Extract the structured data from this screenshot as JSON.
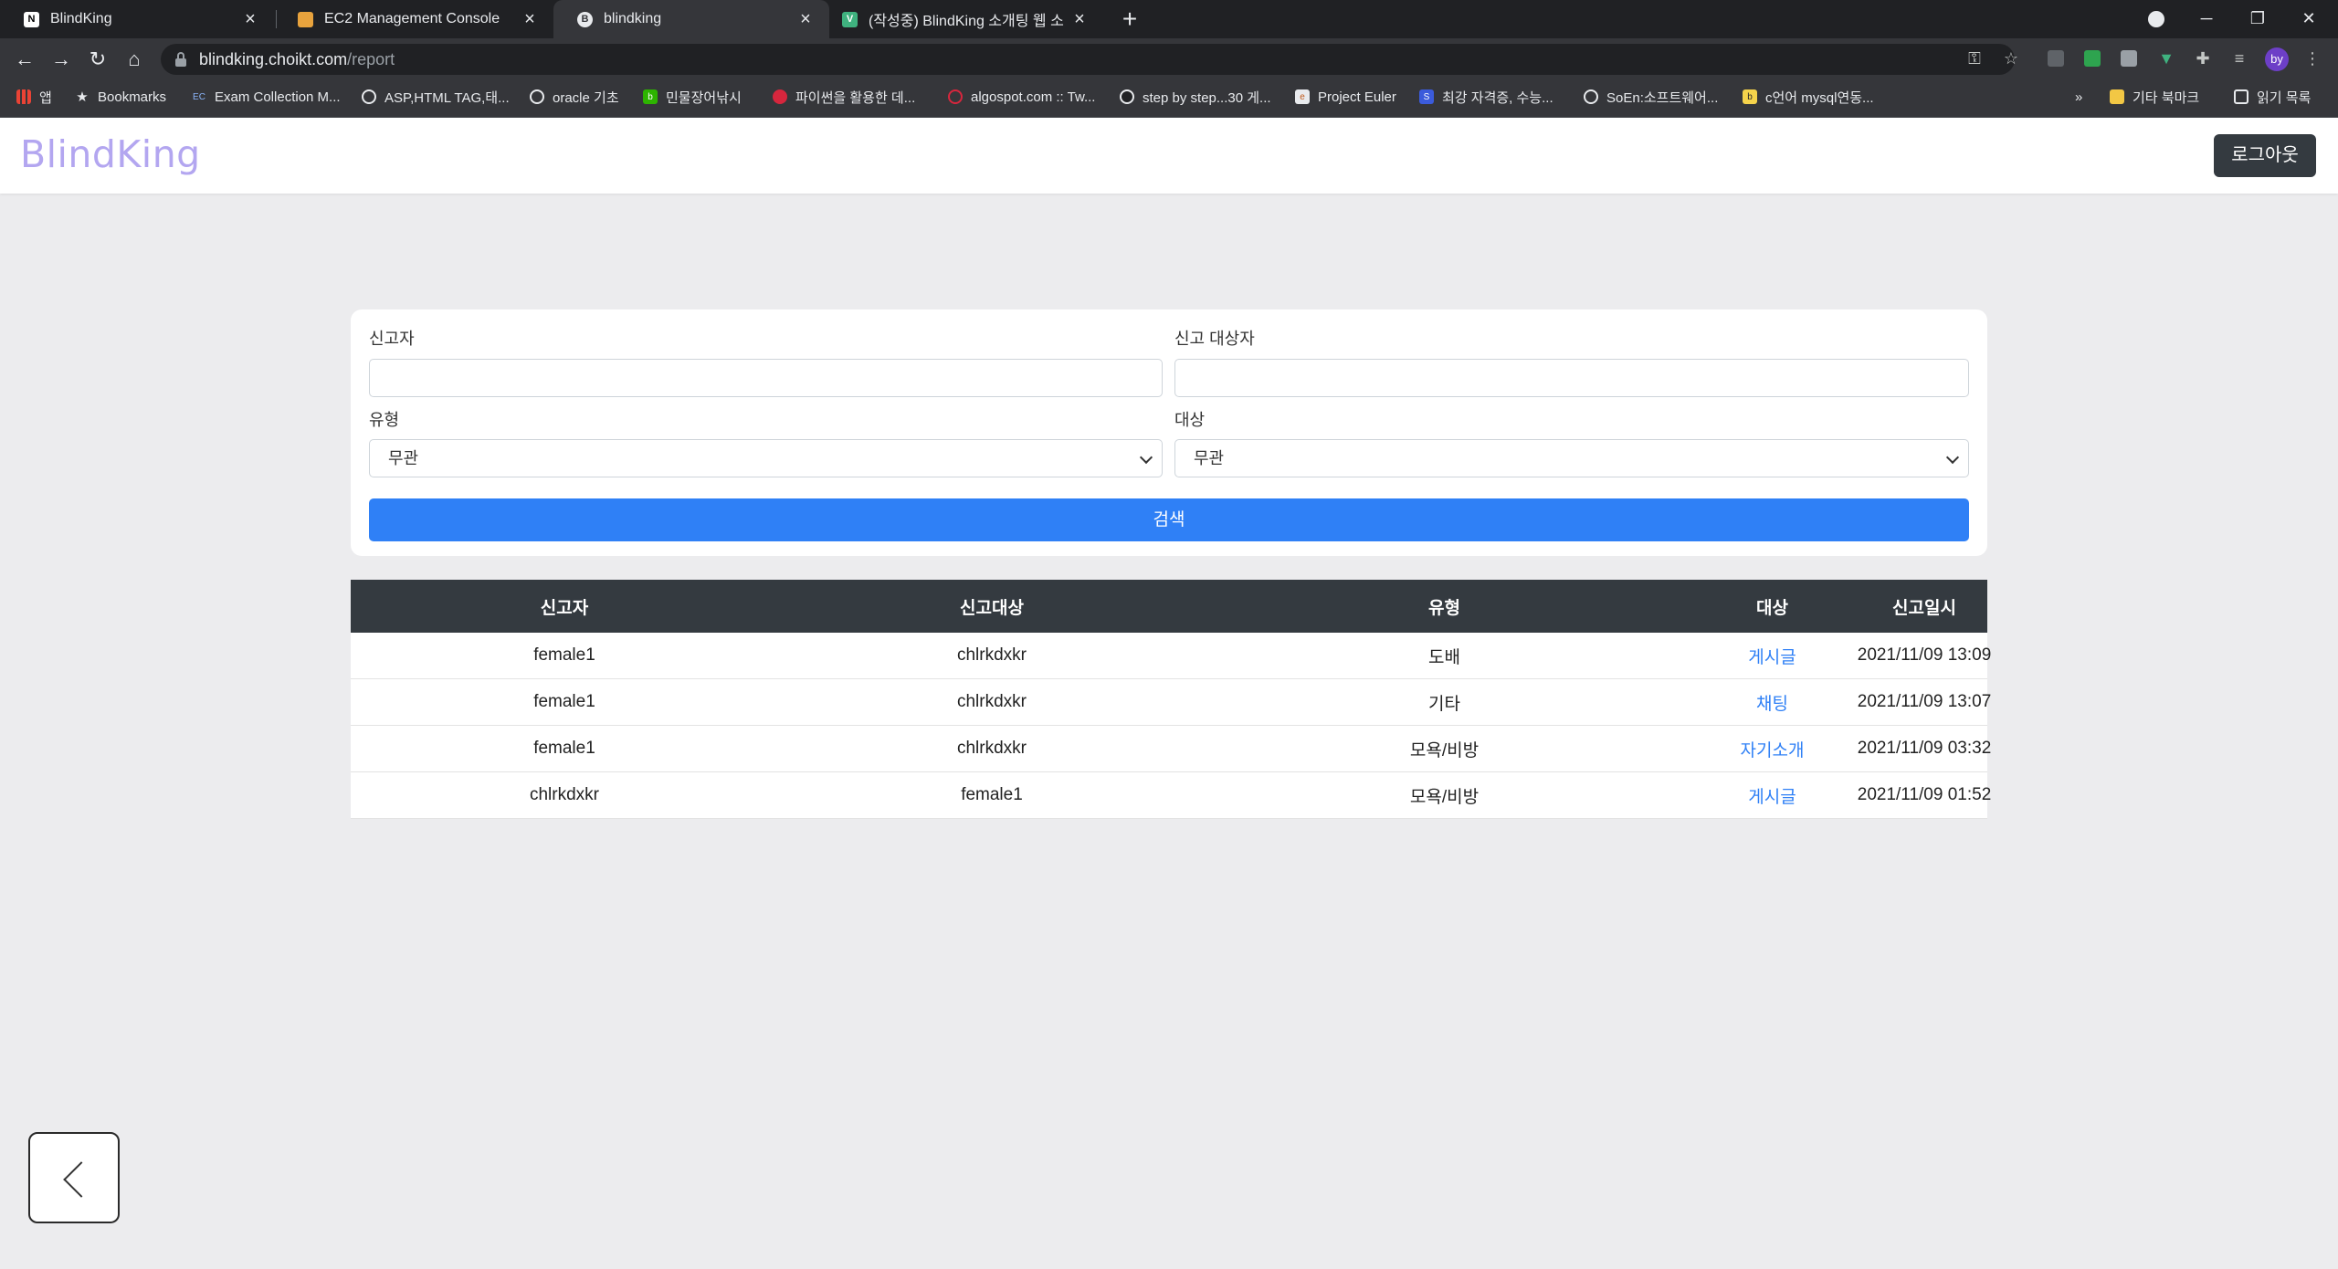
{
  "browser": {
    "tabs": [
      {
        "title": "BlindKing",
        "icon": "notion-icon"
      },
      {
        "title": "EC2 Management Console",
        "icon": "aws-box-icon"
      },
      {
        "title": "blindking",
        "icon": "blindking-icon"
      },
      {
        "title": "(작성중) BlindKing 소개팅 웹 소",
        "icon": "vue-icon"
      }
    ],
    "url_host": "blindking.choikt.com",
    "url_path": "/report",
    "bookmarks": [
      {
        "label": "앱"
      },
      {
        "label": "Bookmarks"
      },
      {
        "label": "Exam Collection M..."
      },
      {
        "label": "ASP,HTML TAG,태..."
      },
      {
        "label": "oracle 기초"
      },
      {
        "label": "민물장어낚시"
      },
      {
        "label": "파이썬을 활용한 데..."
      },
      {
        "label": "algospot.com :: Tw..."
      },
      {
        "label": "step by step...30 게..."
      },
      {
        "label": "Project Euler"
      },
      {
        "label": "최강 자격증, 수능..."
      },
      {
        "label": "SoEn:소프트웨어..."
      },
      {
        "label": "c언어 mysql연동..."
      }
    ],
    "bookmarks_overflow": "»",
    "other_bookmarks": "기타 북마크",
    "reading_list": "읽기 목록",
    "profile_initials": "by"
  },
  "header": {
    "brand": "BlindKing",
    "logout_label": "로그아웃"
  },
  "search": {
    "reporter_label": "신고자",
    "target_user_label": "신고 대상자",
    "type_label": "유형",
    "type_value": "무관",
    "target_label": "대상",
    "target_value": "무관",
    "submit_label": "검색"
  },
  "table": {
    "headers": [
      "신고자",
      "신고대상",
      "유형",
      "대상",
      "신고일시"
    ],
    "rows": [
      {
        "reporter": "female1",
        "reported": "chlrkdxkr",
        "type": "도배",
        "target": "게시글",
        "date": "2021/11/09 13:09"
      },
      {
        "reporter": "female1",
        "reported": "chlrkdxkr",
        "type": "기타",
        "target": "채팅",
        "date": "2021/11/09 13:07"
      },
      {
        "reporter": "female1",
        "reported": "chlrkdxkr",
        "type": "모욕/비방",
        "target": "자기소개",
        "date": "2021/11/09 03:32"
      },
      {
        "reporter": "chlrkdxkr",
        "reported": "female1",
        "type": "모욕/비방",
        "target": "게시글",
        "date": "2021/11/09 01:52"
      }
    ]
  },
  "colors": {
    "brand": "#b3a6f0",
    "primary": "#2f80f6",
    "table_header": "#343a40",
    "page_bg": "#ececee"
  }
}
